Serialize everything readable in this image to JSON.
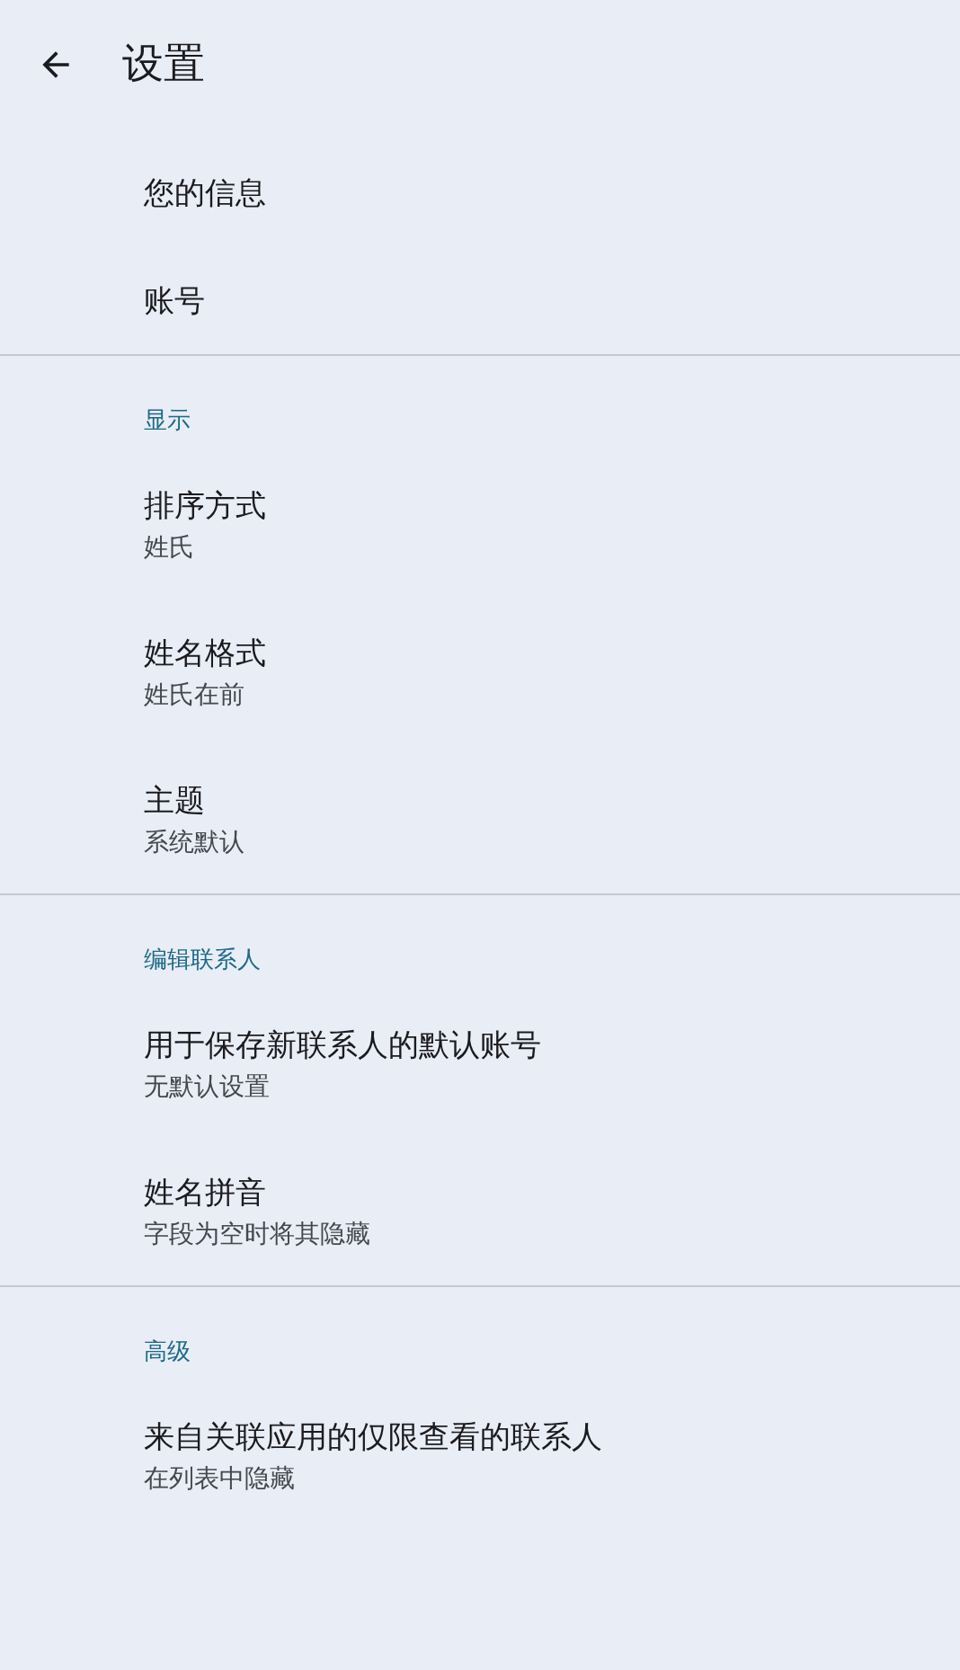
{
  "top_bar": {
    "title": "设置"
  },
  "sections": [
    {
      "items": [
        {
          "title": "您的信息"
        },
        {
          "title": "账号"
        }
      ]
    },
    {
      "heading": "显示",
      "items": [
        {
          "title": "排序方式",
          "subtitle": "姓氏"
        },
        {
          "title": "姓名格式",
          "subtitle": "姓氏在前"
        },
        {
          "title": "主题",
          "subtitle": "系统默认"
        }
      ]
    },
    {
      "heading": "编辑联系人",
      "items": [
        {
          "title": "用于保存新联系人的默认账号",
          "subtitle": "无默认设置"
        },
        {
          "title": "姓名拼音",
          "subtitle": "字段为空时将其隐藏"
        }
      ]
    },
    {
      "heading": "高级",
      "items": [
        {
          "title": "来自关联应用的仅限查看的联系人",
          "subtitle": "在列表中隐藏"
        }
      ]
    }
  ]
}
